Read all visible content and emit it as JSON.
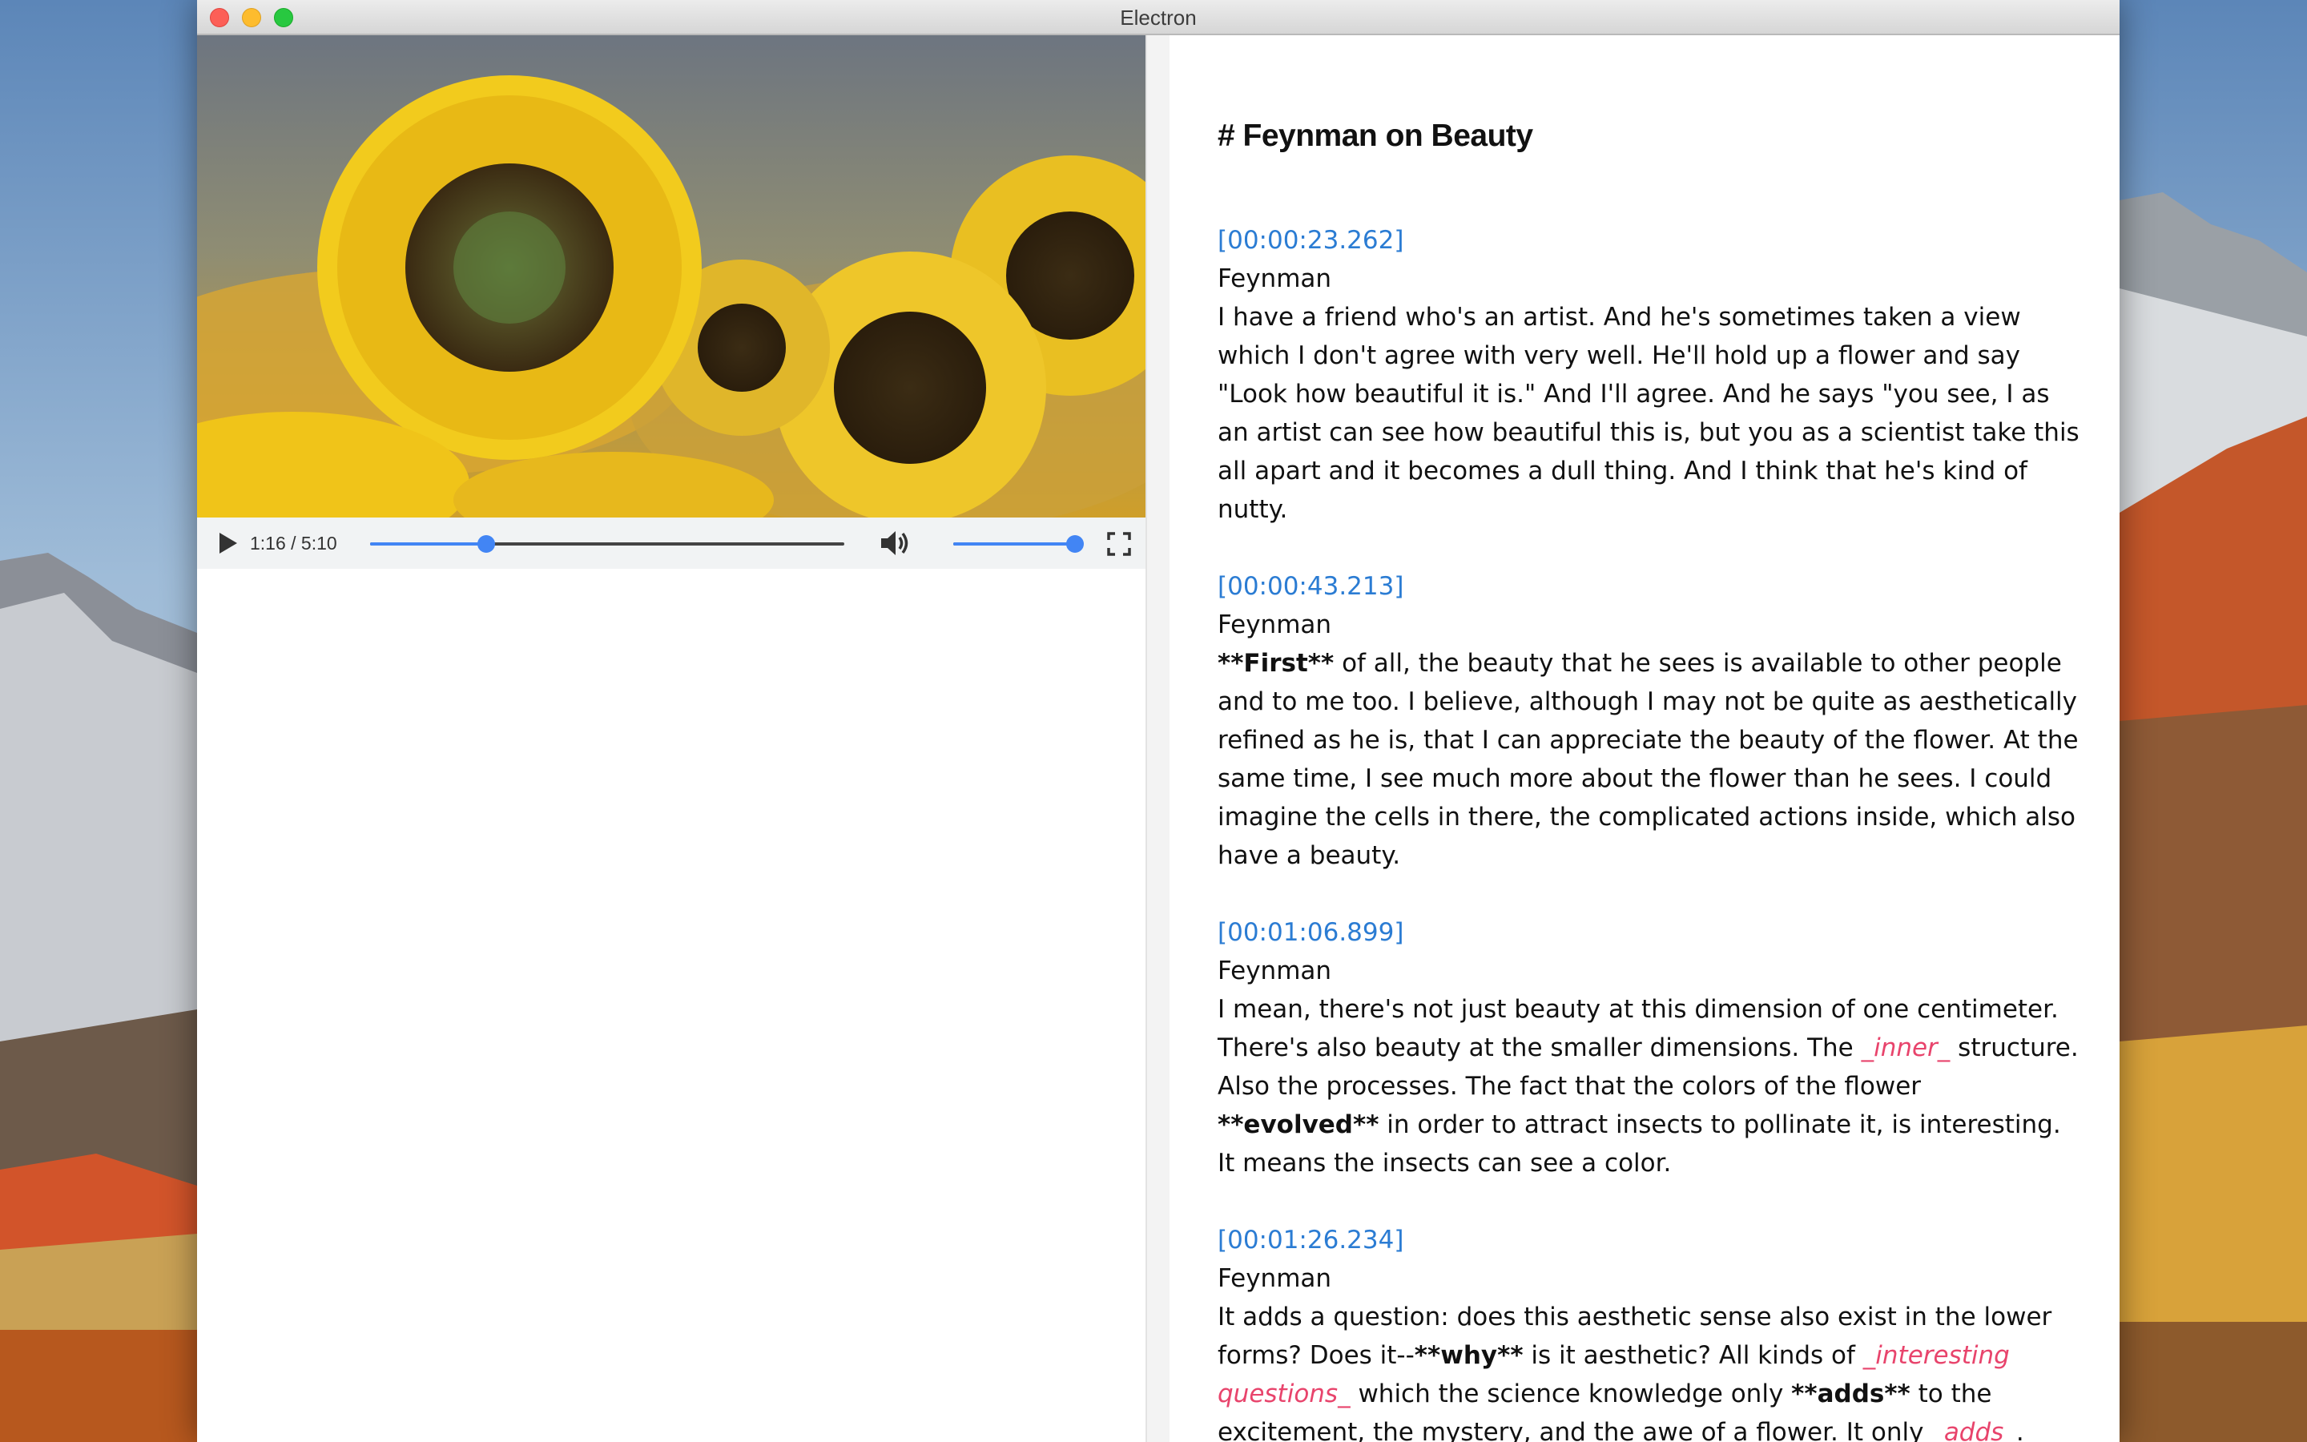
{
  "window": {
    "title": "Electron"
  },
  "player": {
    "time": "1:16 / 5:10",
    "progress_fraction": 0.245,
    "volume_fraction": 1.0,
    "icons": {
      "play": "play-icon",
      "volume": "volume-icon",
      "fullscreen": "fullscreen-icon"
    },
    "accent_color": "#4285f4"
  },
  "transcript": {
    "title": "# Feynman on Beauty",
    "timestamp_color": "#2b7cd3",
    "emphasis_color": "#e8446c",
    "segments": [
      {
        "timestamp": "[00:00:23.262]",
        "speaker": "Feynman",
        "runs": [
          {
            "t": "I have a friend who's an artist. And he's sometimes taken a view which I don't agree with very well. He'll hold up a flower and say \"Look how beautiful it is.\" And I'll agree. And he says \"you see, I as an artist can see how beautiful this is, but you as a scientist take this all apart and it becomes a dull thing. And I think that he's kind of nutty."
          }
        ]
      },
      {
        "timestamp": "[00:00:43.213]",
        "speaker": "Feynman",
        "runs": [
          {
            "t": "**First**",
            "style": "bold"
          },
          {
            "t": " of all, the beauty that he sees is available to other people and to me too. I believe, although I may not be quite as aesthetically refined as he is, that I can appreciate the beauty of the flower. At the same time, I see much more about the flower than he sees. I could imagine the cells in there, the complicated actions inside, which also have a beauty."
          }
        ]
      },
      {
        "timestamp": "[00:01:06.899]",
        "speaker": "Feynman",
        "runs": [
          {
            "t": "I mean, there's not just beauty at this dimension of one centimeter. There's also beauty at the smaller dimensions. The "
          },
          {
            "t": "_inner_",
            "style": "em"
          },
          {
            "t": " structure. Also the processes. The fact that the colors of the flower "
          },
          {
            "t": "**evolved**",
            "style": "bold"
          },
          {
            "t": " in order to attract insects to pollinate it, is interesting. It means the insects can see a color."
          }
        ]
      },
      {
        "timestamp": "[00:01:26.234]",
        "speaker": "Feynman",
        "runs": [
          {
            "t": "It adds a question: does this aesthetic sense also exist in the lower forms? Does it--"
          },
          {
            "t": "**why**",
            "style": "bold"
          },
          {
            "t": " is it aesthetic? All kinds of "
          },
          {
            "t": "_interesting questions_",
            "style": "em"
          },
          {
            "t": " which the science knowledge only "
          },
          {
            "t": "**adds**",
            "style": "bold"
          },
          {
            "t": " to the excitement, the mystery, and the awe of a flower. It only "
          },
          {
            "t": "_adds_",
            "style": "em"
          },
          {
            "t": "."
          }
        ]
      }
    ]
  }
}
